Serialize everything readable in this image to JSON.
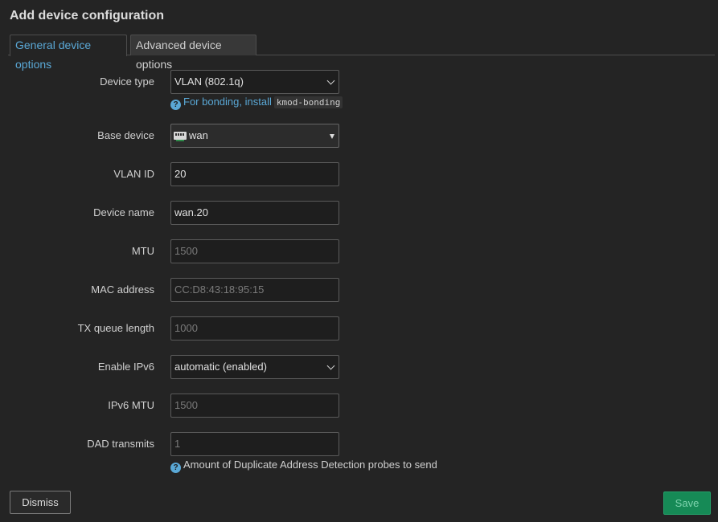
{
  "dialog": {
    "title": "Add device configuration",
    "tabs": [
      {
        "label": "General device options",
        "active": true
      },
      {
        "label": "Advanced device options",
        "active": false
      }
    ]
  },
  "form": {
    "device_type": {
      "label": "Device type",
      "value": "VLAN (802.1q)",
      "hint_text": "For bonding, install",
      "hint_code": "kmod-bonding"
    },
    "base_device": {
      "label": "Base device",
      "value": "wan",
      "icon": "network-port-icon"
    },
    "vlan_id": {
      "label": "VLAN ID",
      "value": "20"
    },
    "device_name": {
      "label": "Device name",
      "value": "wan.20"
    },
    "mtu": {
      "label": "MTU",
      "placeholder": "1500"
    },
    "mac_address": {
      "label": "MAC address",
      "placeholder": "CC:D8:43:18:95:15"
    },
    "tx_queue_length": {
      "label": "TX queue length",
      "placeholder": "1000"
    },
    "enable_ipv6": {
      "label": "Enable IPv6",
      "value": "automatic (enabled)"
    },
    "ipv6_mtu": {
      "label": "IPv6 MTU",
      "placeholder": "1500"
    },
    "dad_transmits": {
      "label": "DAD transmits",
      "placeholder": "1",
      "hint_text": "Amount of Duplicate Address Detection probes to send"
    }
  },
  "buttons": {
    "dismiss": "Dismiss",
    "save": "Save"
  },
  "colors": {
    "background": "#242424",
    "accent": "#5aa8d6",
    "save": "#168a56"
  }
}
